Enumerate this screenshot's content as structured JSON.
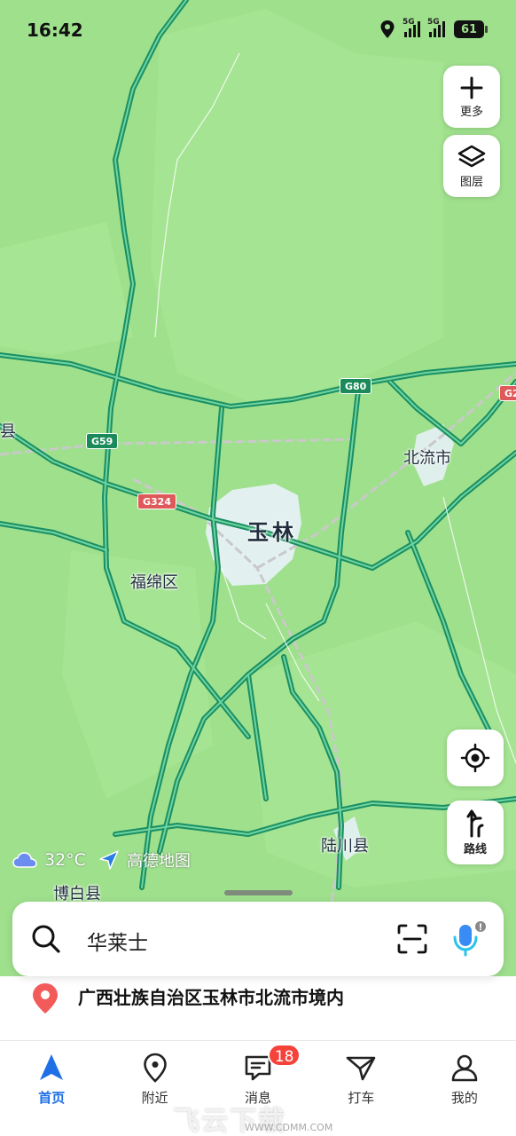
{
  "status_bar": {
    "time": "16:42",
    "net_label_1": "5G",
    "net_label_2": "5G",
    "battery": "61"
  },
  "controls": {
    "more_label": "更多",
    "layers_label": "图层",
    "route_label": "路线"
  },
  "map": {
    "city": "玉林",
    "districts": [
      "北流市",
      "福绵区",
      "陆川县",
      "博白县",
      "县"
    ],
    "road_shields": [
      "G80",
      "G59",
      "G324",
      "G2"
    ]
  },
  "weather": {
    "temperature": "32°C",
    "logo": "高德地图"
  },
  "search": {
    "query": "华莱士"
  },
  "location": {
    "text": "广西壮族自治区玉林市北流市境内"
  },
  "tabs": [
    {
      "label": "首页",
      "icon": "navigation-arrow-icon",
      "active": true
    },
    {
      "label": "附近",
      "icon": "location-pin-icon"
    },
    {
      "label": "消息",
      "icon": "message-icon",
      "badge": "18"
    },
    {
      "label": "打车",
      "icon": "taxi-icon"
    },
    {
      "label": "我的",
      "icon": "user-icon"
    }
  ],
  "watermark": {
    "text": "飞云下载",
    "sub": "WWW.CDMM.COM"
  },
  "colors": {
    "map_bg": "#9fe08d",
    "road": "#27a878",
    "active": "#1f6fe6",
    "badge": "#f5433b"
  }
}
